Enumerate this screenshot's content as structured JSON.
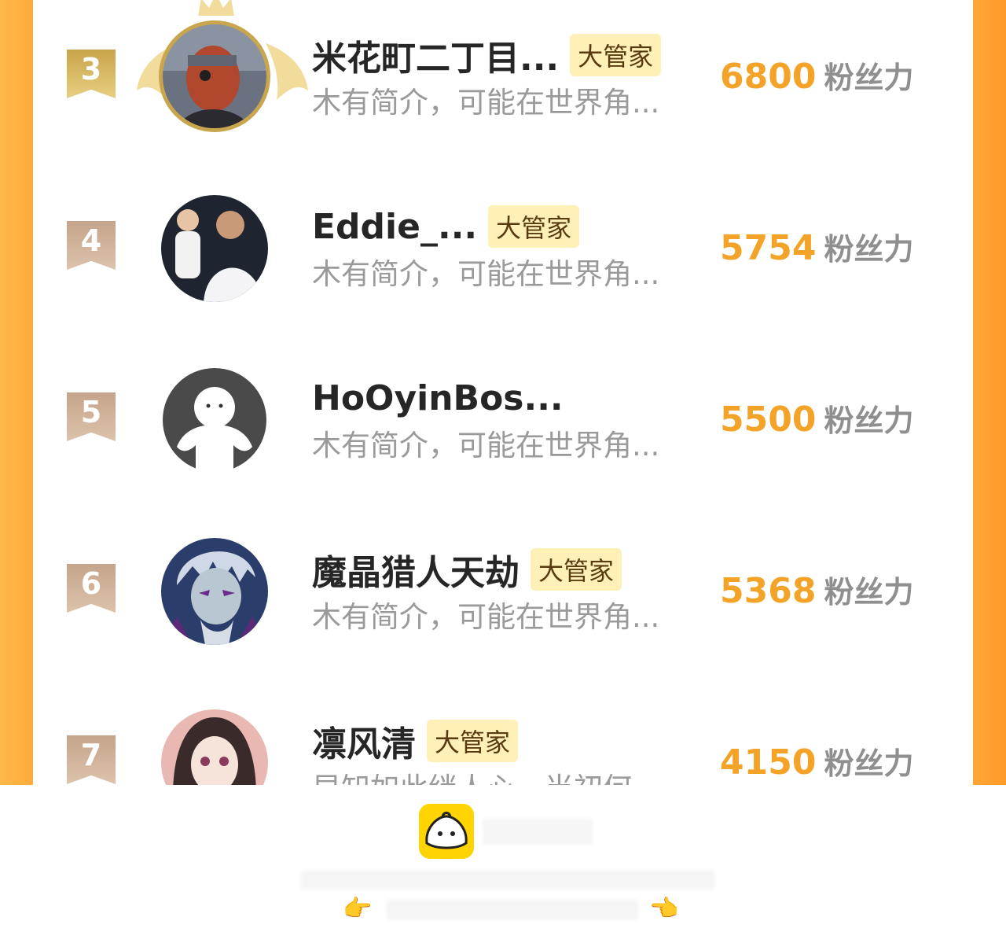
{
  "rows": [
    {
      "rank": "3",
      "name": "米花町二丁目...",
      "badge": "大管家",
      "desc": "木有简介，可能在世界角...",
      "score": "6800",
      "unit": "粉丝力",
      "crowned": true
    },
    {
      "rank": "4",
      "name": "Eddie_...",
      "badge": "大管家",
      "desc": "木有简介，可能在世界角...",
      "score": "5754",
      "unit": "粉丝力"
    },
    {
      "rank": "5",
      "name": "HoOyinBos...",
      "badge": "",
      "desc": "木有简介，可能在世界角...",
      "score": "5500",
      "unit": "粉丝力"
    },
    {
      "rank": "6",
      "name": "魔晶猎人天劫",
      "badge": "大管家",
      "desc": "木有简介，可能在世界角...",
      "score": "5368",
      "unit": "粉丝力"
    },
    {
      "rank": "7",
      "name": "凛风清",
      "badge": "大管家",
      "desc": "早知如此绊人心，当初何",
      "score": "4150",
      "unit": "粉丝力"
    }
  ],
  "icons": {
    "app_logo": "bun-mascot-icon",
    "left_hand": "pointing-right-hand-icon",
    "right_hand": "pointing-left-hand-icon"
  },
  "hands": {
    "left": "👉",
    "right": "👈"
  },
  "colors": {
    "accent": "#f3a327",
    "frame": "#ffa535",
    "badge_bg": "#fff0b8"
  }
}
